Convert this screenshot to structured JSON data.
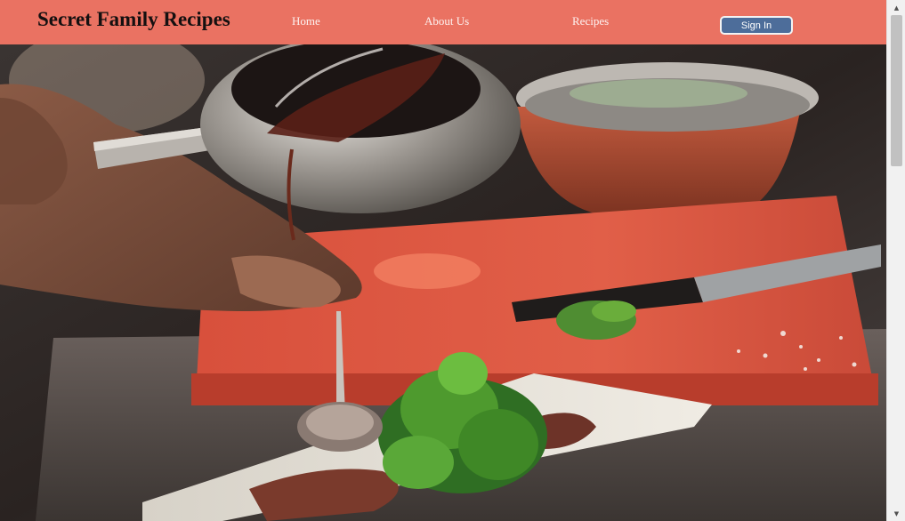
{
  "header": {
    "brand": "Secret Family Recipes",
    "nav": {
      "home": "Home",
      "about": "About Us",
      "recipes": "Recipes"
    },
    "sign_in_label": "Sign In"
  },
  "colors": {
    "header_bg": "#ea7262",
    "sign_in_bg": "#4d6d9a",
    "brand_text": "#141010"
  },
  "icons": {
    "scroll_up": "triangle-up-icon",
    "scroll_down": "triangle-down-icon"
  }
}
